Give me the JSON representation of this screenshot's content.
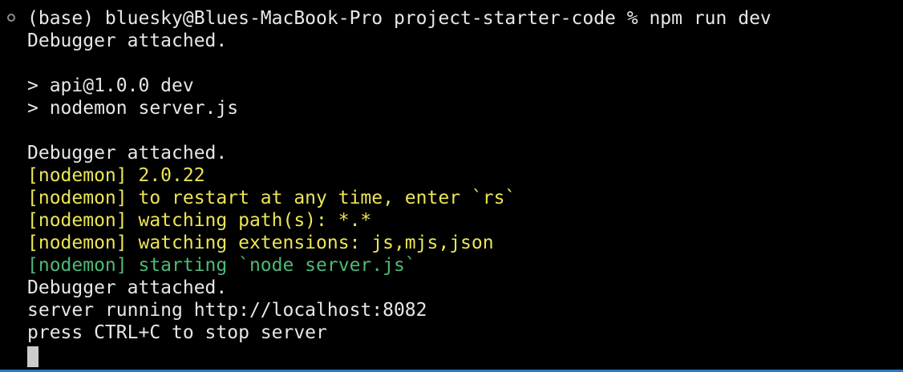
{
  "terminal": {
    "lines": [
      {
        "text": "(base) bluesky@Blues-MacBook-Pro project-starter-code % npm run dev",
        "color": "#e7e7e7"
      },
      {
        "text": "Debugger attached.",
        "color": "#e7e7e7"
      },
      {
        "text": "",
        "color": "#e7e7e7"
      },
      {
        "text": "> api@1.0.0 dev",
        "color": "#e7e7e7"
      },
      {
        "text": "> nodemon server.js",
        "color": "#e7e7e7"
      },
      {
        "text": "",
        "color": "#e7e7e7"
      },
      {
        "text": "Debugger attached.",
        "color": "#e7e7e7"
      },
      {
        "text": "[nodemon] 2.0.22",
        "color": "#ebe556"
      },
      {
        "text": "[nodemon] to restart at any time, enter `rs`",
        "color": "#ebe556"
      },
      {
        "text": "[nodemon] watching path(s): *.*",
        "color": "#ebe556"
      },
      {
        "text": "[nodemon] watching extensions: js,mjs,json",
        "color": "#ebe556"
      },
      {
        "text": "[nodemon] starting `node server.js`",
        "color": "#4fb877"
      },
      {
        "text": "Debugger attached.",
        "color": "#e7e7e7"
      },
      {
        "text": "server running http://localhost:8082",
        "color": "#e7e7e7"
      },
      {
        "text": "press CTRL+C to stop server",
        "color": "#e7e7e7"
      }
    ],
    "prompt_marker_icon": "circle-outline-icon",
    "cursor_icon": "block-cursor-icon",
    "accent_color": "#2b79c2"
  }
}
